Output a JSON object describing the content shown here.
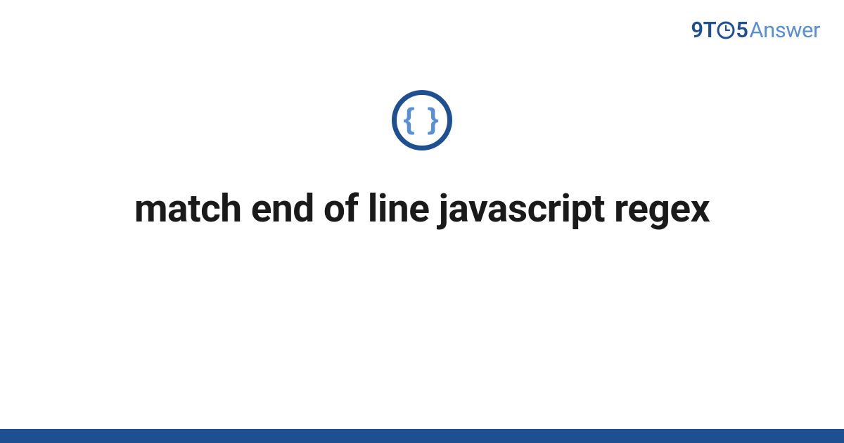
{
  "brand": {
    "part1": "9T",
    "part2": "5",
    "part3": "Answer"
  },
  "center_icon": {
    "glyph": "{ }",
    "name": "code-braces-icon"
  },
  "title": "match end of line javascript regex",
  "colors": {
    "primary": "#1d4f91",
    "accent": "#5a8fd6",
    "text": "#1a1a1a"
  }
}
